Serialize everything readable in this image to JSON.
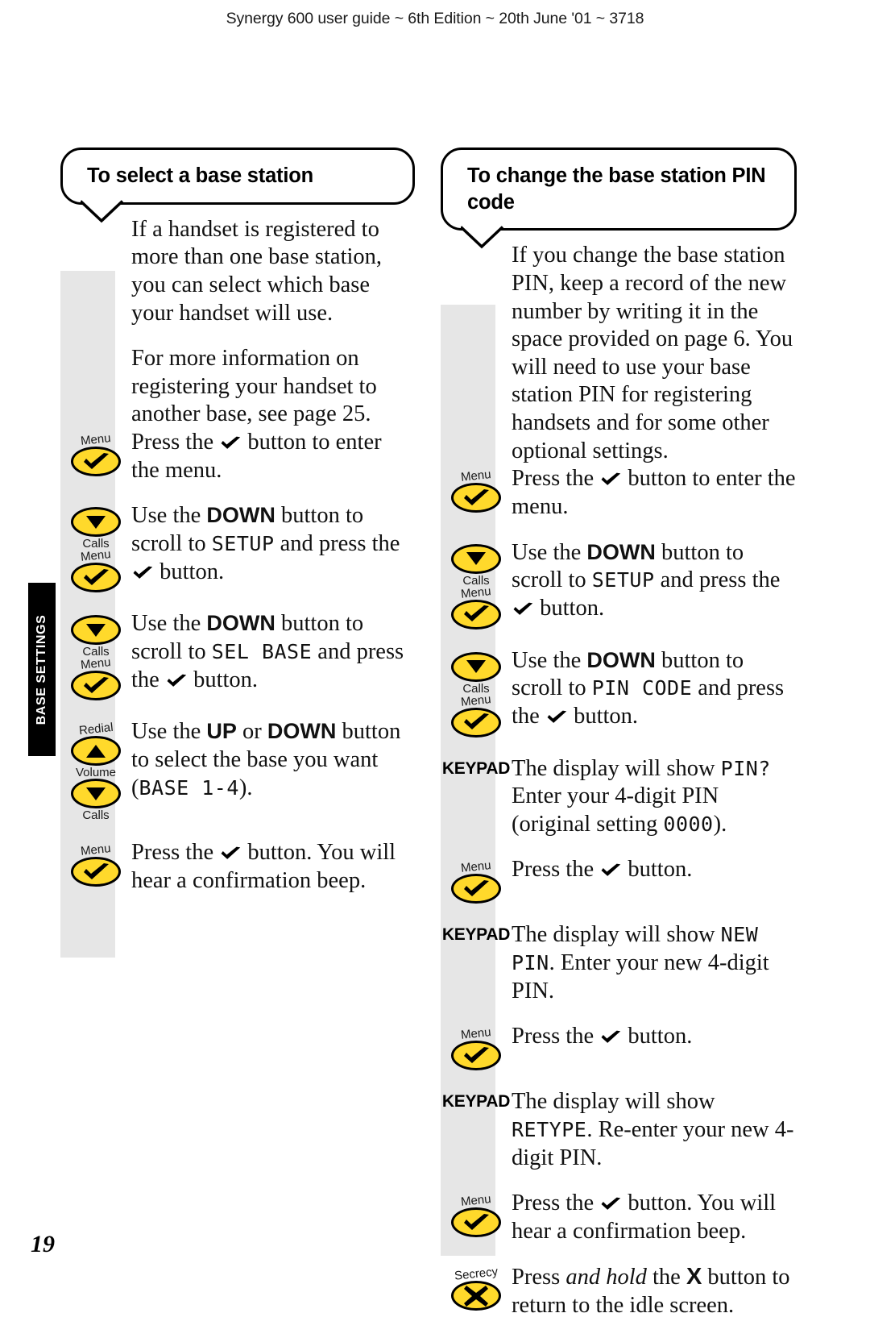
{
  "header": {
    "running_head": "Synergy 600 user guide ~ 6th Edition ~ 20th June '01 ~ 3718"
  },
  "side_tab": {
    "label": "BASE SETTINGS"
  },
  "page_number": "19",
  "colors": {
    "key_yellow": "#FFD92B",
    "rail_grey": "#E6E6E6",
    "tab_black": "#000000",
    "text": "#111111"
  },
  "left_column": {
    "heading": "To select a base station",
    "intro": [
      "If a handset is registered to more than one base station, you can select which base your handset will use.",
      "For more information on registering your handset to another base, see page 25."
    ],
    "steps": [
      {
        "icon": {
          "type": "key-tick",
          "label_above": "Menu",
          "glyph": "tick-icon"
        },
        "text_parts": [
          {
            "kind": "plain",
            "text": "Press the "
          },
          {
            "kind": "tick"
          },
          {
            "kind": "plain",
            "text": " button to enter the menu."
          }
        ]
      },
      {
        "icon": {
          "type": "key-down",
          "label_below": "Calls",
          "glyph": "down-arrow-icon"
        },
        "icon2": {
          "type": "key-tick",
          "label_above": "Menu",
          "glyph": "tick-icon"
        },
        "text_parts": [
          {
            "kind": "plain",
            "text": "Use the "
          },
          {
            "kind": "boldsans",
            "text": "DOWN"
          },
          {
            "kind": "plain",
            "text": " button to scroll to "
          },
          {
            "kind": "lcd",
            "text": "SETUP"
          },
          {
            "kind": "plain",
            "text": " and press the "
          },
          {
            "kind": "tick"
          },
          {
            "kind": "plain",
            "text": " button."
          }
        ]
      },
      {
        "icon": {
          "type": "key-down",
          "label_below": "Calls",
          "glyph": "down-arrow-icon"
        },
        "icon2": {
          "type": "key-tick",
          "label_above": "Menu",
          "glyph": "tick-icon"
        },
        "text_parts": [
          {
            "kind": "plain",
            "text": "Use the "
          },
          {
            "kind": "boldsans",
            "text": "DOWN"
          },
          {
            "kind": "plain",
            "text": " button to scroll to "
          },
          {
            "kind": "lcd",
            "text": "SEL BASE"
          },
          {
            "kind": "plain",
            "text": " and press the "
          },
          {
            "kind": "tick"
          },
          {
            "kind": "plain",
            "text": " button."
          }
        ]
      },
      {
        "icon": {
          "type": "key-up",
          "label_above": "Redial",
          "label_below": "Volume",
          "glyph": "up-arrow-icon"
        },
        "icon2": {
          "type": "key-down",
          "label_below": "Calls",
          "glyph": "down-arrow-icon"
        },
        "text_parts": [
          {
            "kind": "plain",
            "text": "Use the "
          },
          {
            "kind": "boldsans",
            "text": "UP"
          },
          {
            "kind": "plain",
            "text": " or "
          },
          {
            "kind": "boldsans",
            "text": "DOWN"
          },
          {
            "kind": "plain",
            "text": " button to select the base you want ("
          },
          {
            "kind": "lcd",
            "text": "BASE 1-4"
          },
          {
            "kind": "plain",
            "text": ")."
          }
        ]
      },
      {
        "icon": {
          "type": "key-tick",
          "label_above": "Menu",
          "glyph": "tick-icon"
        },
        "text_parts": [
          {
            "kind": "plain",
            "text": "Press the "
          },
          {
            "kind": "tick"
          },
          {
            "kind": "plain",
            "text": " button. You will hear a confirmation beep."
          }
        ]
      }
    ]
  },
  "right_column": {
    "heading": "To change the base station PIN code",
    "intro": [
      "If you change the base station PIN, keep a record of the new number by writing it in the space provided on page 6. You will need to use your base station PIN for registering handsets and for some other optional settings."
    ],
    "steps": [
      {
        "icon": {
          "type": "key-tick",
          "label_above": "Menu",
          "glyph": "tick-icon"
        },
        "text_parts": [
          {
            "kind": "plain",
            "text": "Press the "
          },
          {
            "kind": "tick"
          },
          {
            "kind": "plain",
            "text": " button to enter the menu."
          }
        ]
      },
      {
        "icon": {
          "type": "key-down",
          "label_below": "Calls",
          "glyph": "down-arrow-icon"
        },
        "icon2": {
          "type": "key-tick",
          "label_above": "Menu",
          "glyph": "tick-icon"
        },
        "text_parts": [
          {
            "kind": "plain",
            "text": "Use the "
          },
          {
            "kind": "boldsans",
            "text": "DOWN"
          },
          {
            "kind": "plain",
            "text": " button to scroll to "
          },
          {
            "kind": "lcd",
            "text": "SETUP"
          },
          {
            "kind": "plain",
            "text": " and press the "
          },
          {
            "kind": "tick"
          },
          {
            "kind": "plain",
            "text": " button."
          }
        ]
      },
      {
        "icon": {
          "type": "key-down",
          "label_below": "Calls",
          "glyph": "down-arrow-icon"
        },
        "icon2": {
          "type": "key-tick",
          "label_above": "Menu",
          "glyph": "tick-icon"
        },
        "text_parts": [
          {
            "kind": "plain",
            "text": "Use the "
          },
          {
            "kind": "boldsans",
            "text": "DOWN"
          },
          {
            "kind": "plain",
            "text": " button to scroll to "
          },
          {
            "kind": "lcd",
            "text": "PIN CODE"
          },
          {
            "kind": "plain",
            "text": " and press the "
          },
          {
            "kind": "tick"
          },
          {
            "kind": "plain",
            "text": " button."
          }
        ]
      },
      {
        "icon": {
          "type": "keypad",
          "label": "KEYPAD"
        },
        "text_parts": [
          {
            "kind": "plain",
            "text": "The display will show "
          },
          {
            "kind": "lcd",
            "text": "PIN?"
          },
          {
            "kind": "plain",
            "text": " Enter your 4-digit PIN (original setting "
          },
          {
            "kind": "lcd",
            "text": "0000"
          },
          {
            "kind": "plain",
            "text": ")."
          }
        ]
      },
      {
        "icon": {
          "type": "key-tick",
          "label_above": "Menu",
          "glyph": "tick-icon"
        },
        "text_parts": [
          {
            "kind": "plain",
            "text": "Press the "
          },
          {
            "kind": "tick"
          },
          {
            "kind": "plain",
            "text": " button."
          }
        ]
      },
      {
        "icon": {
          "type": "keypad",
          "label": "KEYPAD"
        },
        "text_parts": [
          {
            "kind": "plain",
            "text": "The display will show "
          },
          {
            "kind": "lcd",
            "text": "NEW PIN"
          },
          {
            "kind": "plain",
            "text": ". Enter your new 4-digit PIN."
          }
        ]
      },
      {
        "icon": {
          "type": "key-tick",
          "label_above": "Menu",
          "glyph": "tick-icon"
        },
        "text_parts": [
          {
            "kind": "plain",
            "text": "Press the "
          },
          {
            "kind": "tick"
          },
          {
            "kind": "plain",
            "text": " button."
          }
        ]
      },
      {
        "icon": {
          "type": "keypad",
          "label": "KEYPAD"
        },
        "text_parts": [
          {
            "kind": "plain",
            "text": "The display will show "
          },
          {
            "kind": "lcd",
            "text": "RETYPE"
          },
          {
            "kind": "plain",
            "text": ". Re-enter your new 4-digit PIN."
          }
        ]
      },
      {
        "icon": {
          "type": "key-tick",
          "label_above": "Menu",
          "glyph": "tick-icon"
        },
        "text_parts": [
          {
            "kind": "plain",
            "text": "Press the "
          },
          {
            "kind": "tick"
          },
          {
            "kind": "plain",
            "text": " button. You will hear a confirmation beep."
          }
        ]
      },
      {
        "icon": {
          "type": "key-cross",
          "label_above": "Secrecy",
          "glyph": "cross-icon"
        },
        "text_parts": [
          {
            "kind": "plain",
            "text": "Press "
          },
          {
            "kind": "italic",
            "text": "and hold"
          },
          {
            "kind": "plain",
            "text": " the "
          },
          {
            "kind": "boldx",
            "text": "X"
          },
          {
            "kind": "plain",
            "text": " button to return to the idle screen."
          }
        ]
      }
    ]
  }
}
